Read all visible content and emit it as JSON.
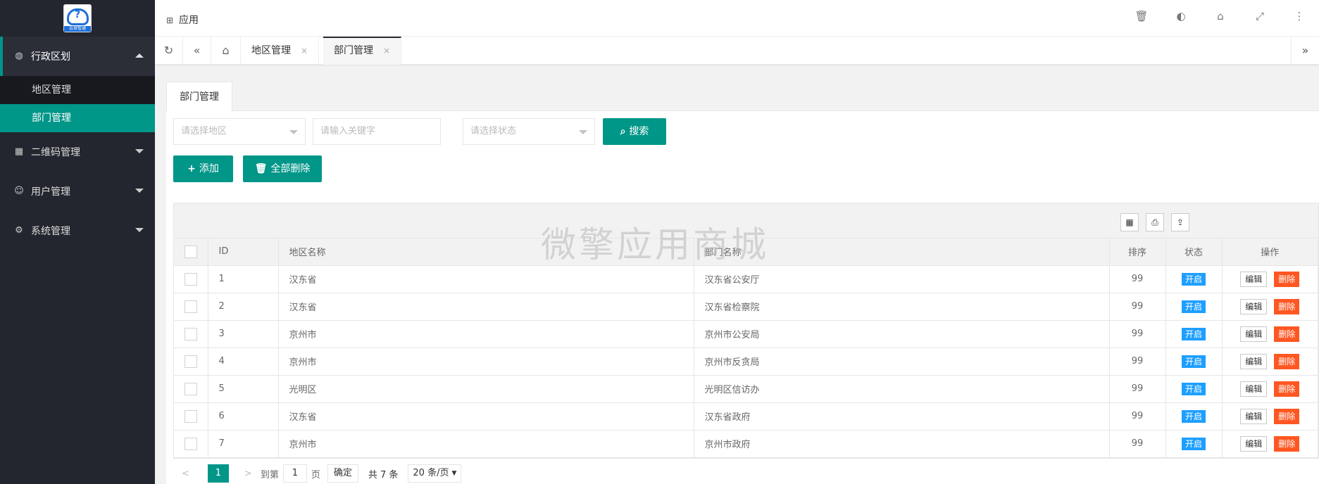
{
  "brand": {
    "logo_text": "云慧智通"
  },
  "sidebar": {
    "groups": [
      {
        "label": "行政区划",
        "icon": "globe-icon"
      },
      {
        "label": "二维码管理",
        "icon": "qrcode-icon"
      },
      {
        "label": "用户管理",
        "icon": "user-icon"
      },
      {
        "label": "系统管理",
        "icon": "gear-icon"
      }
    ],
    "sub_items": [
      "地区管理",
      "部门管理"
    ]
  },
  "topbar": {
    "app_label": "应用"
  },
  "tabs": {
    "items": [
      "地区管理",
      "部门管理"
    ],
    "close": "×"
  },
  "panel": {
    "tab_label": "部门管理"
  },
  "filters": {
    "region_placeholder": "请选择地区",
    "keyword_placeholder": "请输入关键字",
    "status_placeholder": "请选择状态",
    "search_label": "搜索"
  },
  "actions": {
    "add_label": "添加",
    "delete_all_label": "全部删除"
  },
  "table": {
    "headers": {
      "id": "ID",
      "region": "地区名称",
      "dept": "部门名称",
      "sort": "排序",
      "status": "状态",
      "ops": "操作"
    },
    "edit_label": "编辑",
    "delete_label": "删除",
    "rows": [
      {
        "id": "1",
        "region": "汉东省",
        "dept": "汉东省公安厅",
        "sort": "99",
        "status": "开启"
      },
      {
        "id": "2",
        "region": "汉东省",
        "dept": "汉东省检察院",
        "sort": "99",
        "status": "开启"
      },
      {
        "id": "3",
        "region": "京州市",
        "dept": "京州市公安局",
        "sort": "99",
        "status": "开启"
      },
      {
        "id": "4",
        "region": "京州市",
        "dept": "京州市反贪局",
        "sort": "99",
        "status": "开启"
      },
      {
        "id": "5",
        "region": "光明区",
        "dept": "光明区信访办",
        "sort": "99",
        "status": "开启"
      },
      {
        "id": "6",
        "region": "汉东省",
        "dept": "汉东省政府",
        "sort": "99",
        "status": "开启"
      },
      {
        "id": "7",
        "region": "京州市",
        "dept": "京州市政府",
        "sort": "99",
        "status": "开启"
      }
    ]
  },
  "pager": {
    "current_page": "1",
    "goto_label": "到第",
    "page_input": "1",
    "page_unit": "页",
    "confirm_label": "确定",
    "total_label": "共 7 条",
    "page_size": "20 条/页"
  },
  "watermark": "微擎应用商城",
  "colors": {
    "accent": "#009688",
    "badge": "#1e9fff",
    "danger": "#ff5722",
    "sidebar": "#23262e"
  }
}
